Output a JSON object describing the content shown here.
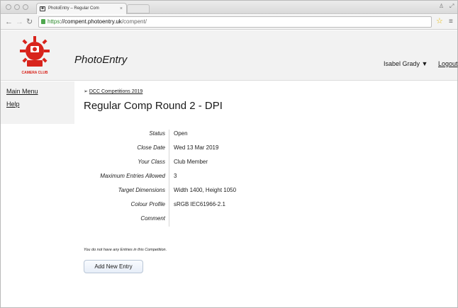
{
  "browser": {
    "tab_title": "PhotoEntry – Regular Com",
    "tab_close": "×",
    "url": {
      "scheme": "https",
      "rest_host": "://compent.photoentry.uk",
      "path": "/compent/"
    },
    "icons": [
      "back-arrow-icon",
      "forward-arrow-icon",
      "reload-icon",
      "lock-icon",
      "star-icon",
      "menu-icon"
    ]
  },
  "header": {
    "logo_text": "CAMERA CLUB",
    "site_name": "PhotoEntry",
    "user_name": "Isabel Grady ▼",
    "logout_label": "Logout"
  },
  "sidebar": {
    "items": [
      {
        "label": "Main Menu"
      },
      {
        "label": "Help"
      }
    ]
  },
  "main": {
    "breadcrumb_prefix": "➢",
    "breadcrumb": "DCC Competitions 2019",
    "title": "Regular Comp Round 2 - DPI",
    "details": [
      {
        "label": "Status",
        "value": "Open"
      },
      {
        "label": "Close Date",
        "value": "Wed 13 Mar 2019"
      },
      {
        "label": "Your Class",
        "value": "Club Member"
      },
      {
        "label": "Maximum Entries Allowed",
        "value": "3"
      },
      {
        "label": "Target Dimensions",
        "value": "Width 1400, Height 1050"
      },
      {
        "label": "Colour Profile",
        "value": "sRGB IEC61966-2.1"
      },
      {
        "label": "Comment",
        "value": ""
      }
    ],
    "no_entries_text": "You do not have any Entries in this Competition.",
    "add_button": "Add New Entry"
  },
  "colors": {
    "logo_red": "#d8241c",
    "secure_green": "#2e8b2e",
    "header_bg": "#f2f2f2"
  }
}
